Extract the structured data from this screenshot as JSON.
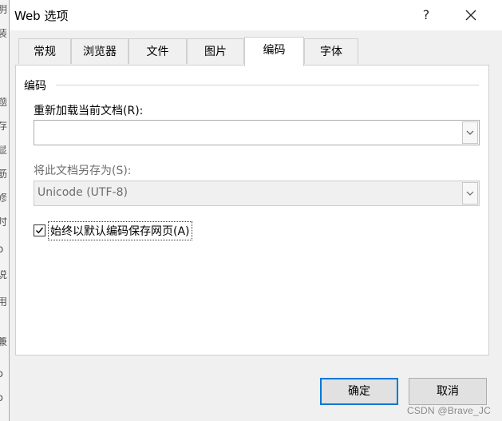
{
  "background": {
    "glyphs": [
      "明",
      "装",
      "",
      "",
      "题",
      "存",
      "显",
      "",
      "筋",
      "修",
      "时",
      "b",
      "说",
      "",
      "用",
      "",
      "兼",
      "",
      "o",
      "o"
    ]
  },
  "dialog": {
    "title": "Web 选项",
    "help_symbol": "?",
    "close_symbol": "✕"
  },
  "tabs": [
    {
      "label": "常规",
      "active": false
    },
    {
      "label": "浏览器",
      "active": false
    },
    {
      "label": "文件",
      "active": false
    },
    {
      "label": "图片",
      "active": false
    },
    {
      "label": "编码",
      "active": true
    },
    {
      "label": "字体",
      "active": false
    }
  ],
  "encoding": {
    "group_label": "编码",
    "reload_label": "重新加载当前文档(R):",
    "reload_value": "",
    "save_as_label": "将此文档另存为(S):",
    "save_as_value": "Unicode (UTF-8)",
    "always_save_default_label": "始终以默认编码保存网页(A)",
    "always_save_default_checked": true
  },
  "buttons": {
    "ok": "确定",
    "cancel": "取消"
  },
  "watermark": "CSDN @Brave_JC",
  "colors": {
    "accent": "#0078d7",
    "dialog_bg": "#f0f0f0",
    "panel_bg": "#ffffff",
    "disabled_text": "#6d6d6d"
  }
}
